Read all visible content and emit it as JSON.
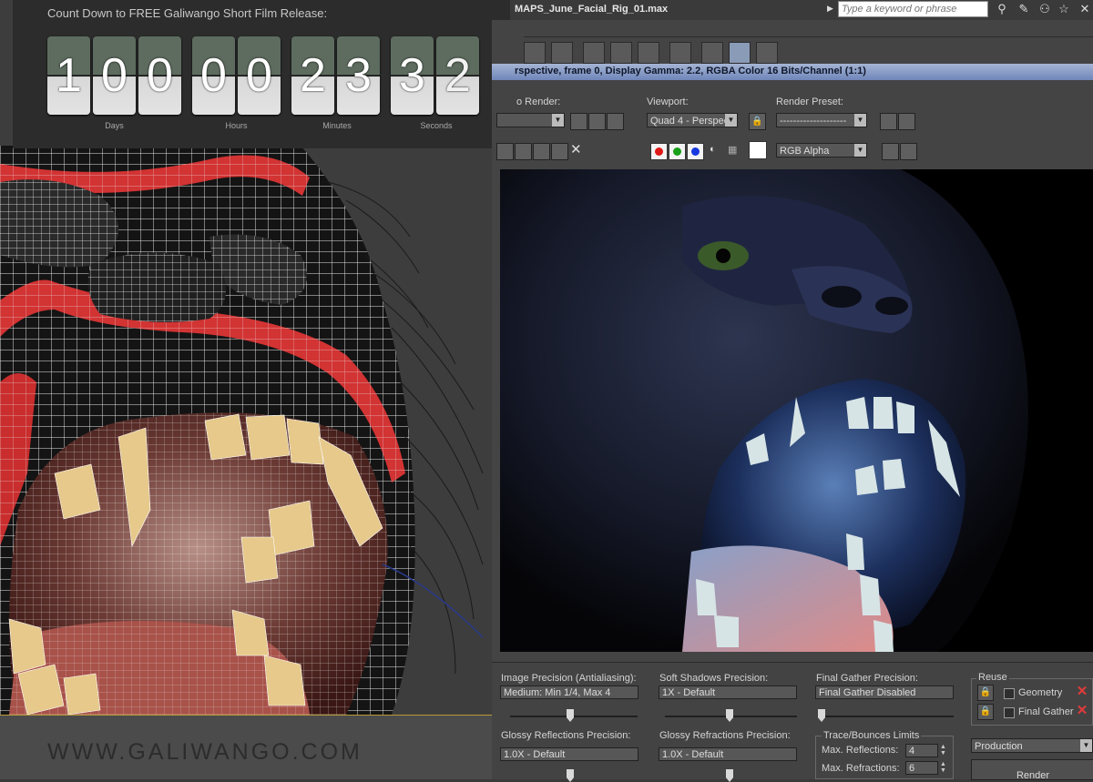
{
  "countdown": {
    "title": "Count Down to FREE Galiwango Short Film Release:",
    "digits": [
      "1",
      "0",
      "0",
      "0",
      "0",
      "2",
      "3",
      "3",
      "2"
    ],
    "labels": {
      "days": "Days",
      "hours": "Hours",
      "minutes": "Minutes",
      "seconds": "Seconds"
    }
  },
  "watermark": "WWW.GALIWANGO.COM",
  "app": {
    "file_title": "MAPS_June_Facial_Rig_01.max",
    "search_placeholder": "Type a keyword or phrase",
    "icons": [
      "binoculars-icon",
      "tools-icon",
      "star-icon",
      "close-icon"
    ]
  },
  "render_window": {
    "frame_title": "rspective, frame 0, Display Gamma: 2.2, RGBA Color 16 Bits/Channel (1:1)",
    "area_to_render_label": "o Render:",
    "viewport_label": "Viewport:",
    "viewport_value": "Quad 4 - Perspec",
    "preset_label": "Render Preset:",
    "preset_value": "--------------------",
    "channel_value": "RGB Alpha",
    "channel_colors": [
      "#e01818",
      "#18a018",
      "#1838e0"
    ]
  },
  "settings": {
    "image_precision_label": "Image Precision (Antialiasing):",
    "image_precision_value": "Medium: Min 1/4, Max 4",
    "soft_shadows_label": "Soft Shadows Precision:",
    "soft_shadows_value": "1X - Default",
    "final_gather_label": "Final Gather Precision:",
    "final_gather_value": "Final Gather Disabled",
    "glossy_reflections_label": "Glossy Reflections Precision:",
    "glossy_reflections_value": "1.0X - Default",
    "glossy_refractions_label": "Glossy Refractions Precision:",
    "glossy_refractions_value": "1.0X - Default",
    "trace_label": "Trace/Bounces Limits",
    "max_reflections_label": "Max. Reflections:",
    "max_reflections_value": "4",
    "max_refractions_label": "Max. Refractions:",
    "max_refractions_value": "6",
    "reuse_label": "Reuse",
    "geometry_label": "Geometry",
    "final_gather_reuse_label": "Final Gather",
    "production_value": "Production",
    "render_button": "Render"
  }
}
